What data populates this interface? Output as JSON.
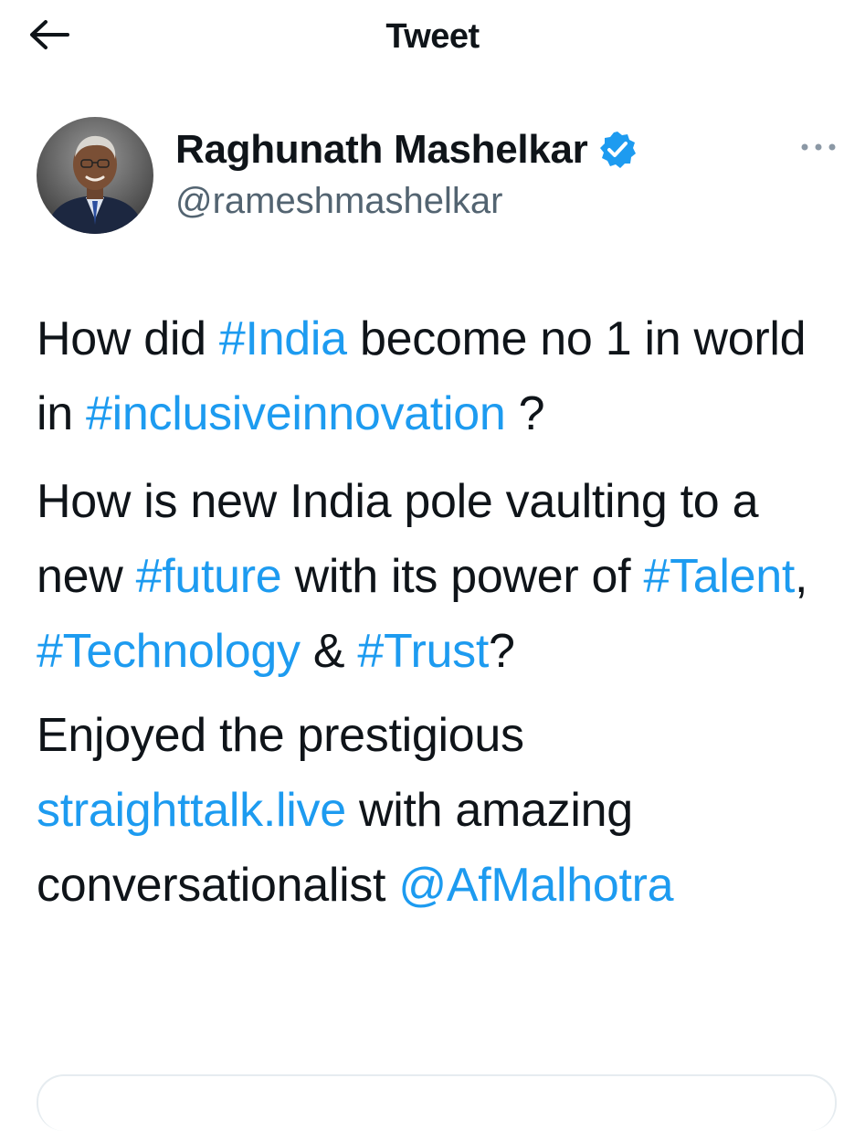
{
  "header": {
    "title": "Tweet"
  },
  "author": {
    "display_name": "Raghunath Mashelkar",
    "handle": "@rameshmashelkar",
    "verified": true
  },
  "tweet": {
    "p1": {
      "t1": "How did ",
      "tag_india": "#India",
      "t2": " become no 1 in world in ",
      "tag_inclusive": "#inclusiveinnovation",
      "t3": " ?"
    },
    "p2": {
      "t1": "How is new India pole vaulting to a new ",
      "tag_future": "#future",
      "t2": " with its power of ",
      "tag_talent": "#Talent",
      "t3": ", ",
      "tag_technology": "#Technology",
      "t4": " & ",
      "tag_trust": "#Trust",
      "t5": "?"
    },
    "p3": {
      "t1": "Enjoyed the prestigious ",
      "link": "straighttalk.live",
      "t2": " with amazing conversationalist ",
      "mention": "@AfMalhotra"
    }
  },
  "colors": {
    "accent": "#1d9bf0",
    "text": "#0f1419",
    "secondary": "#536471"
  },
  "icons": {
    "back": "arrow-left-icon",
    "verified": "verified-badge-icon",
    "more": "more-horizontal-icon"
  }
}
